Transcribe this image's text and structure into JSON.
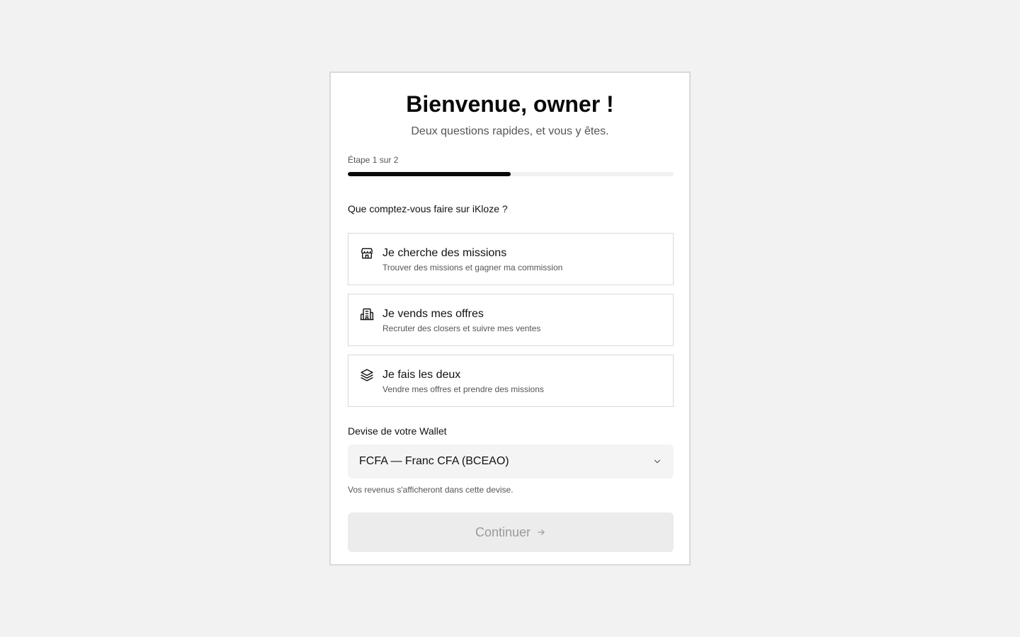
{
  "header": {
    "title": "Bienvenue, owner !",
    "subtitle": "Deux questions rapides, et vous y êtes."
  },
  "progress": {
    "label": "Étape 1 sur 2",
    "current_step": 1,
    "total_steps": 2,
    "fraction": 0.5
  },
  "question": "Que comptez-vous faire sur iKloze ?",
  "options": [
    {
      "title": "Je cherche des missions",
      "description": "Trouver des missions et gagner ma commission",
      "icon": "store-icon"
    },
    {
      "title": "Je vends mes offres",
      "description": "Recruter des closers et suivre mes ventes",
      "icon": "building-icon"
    },
    {
      "title": "Je fais les deux",
      "description": "Vendre mes offres et prendre des missions",
      "icon": "layers-icon"
    }
  ],
  "wallet": {
    "label": "Devise de votre Wallet",
    "selected": "FCFA — Franc CFA (BCEAO)",
    "hint": "Vos revenus s'afficheront dans cette devise."
  },
  "continue_button": {
    "label": "Continuer",
    "disabled": true
  },
  "colors": {
    "background": "#f2f2f2",
    "card": "#ffffff",
    "progress_fill": "#0a0a0a",
    "button_disabled_bg": "#ececec",
    "button_disabled_text": "#9a9a9a"
  }
}
